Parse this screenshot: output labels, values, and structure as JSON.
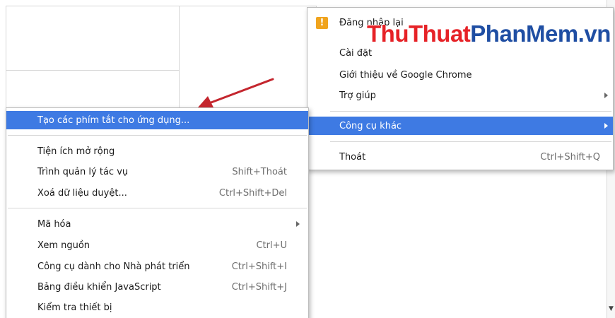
{
  "main_menu": {
    "items": [
      {
        "label": "Đăng nhập lại"
      },
      {
        "label": "Cài đặt"
      },
      {
        "label": "Giới thiệu về Google Chrome"
      },
      {
        "label": "Trợ giúp"
      },
      {
        "label": "Công cụ khác"
      },
      {
        "label": "Thoát",
        "shortcut": "Ctrl+Shift+Q"
      }
    ],
    "warning_icon_glyph": "!"
  },
  "sub_menu": {
    "items": [
      {
        "label": "Tạo các phím tắt cho ứng dụng..."
      },
      {
        "label": "Tiện ích mở rộng"
      },
      {
        "label": "Trình quản lý tác vụ",
        "shortcut": "Shift+Thoát"
      },
      {
        "label": "Xoá dữ liệu duyệt...",
        "shortcut": "Ctrl+Shift+Del"
      },
      {
        "label": "Mã hóa"
      },
      {
        "label": "Xem nguồn",
        "shortcut": "Ctrl+U"
      },
      {
        "label": "Công cụ dành cho Nhà phát triển",
        "shortcut": "Ctrl+Shift+I"
      },
      {
        "label": "Bảng điều khiển JavaScript",
        "shortcut": "Ctrl+Shift+J"
      },
      {
        "label": "Kiểm tra thiết bị"
      }
    ]
  },
  "watermark": {
    "part1": "ThuThuat",
    "part2": "PhanMem",
    "part3": ".vn"
  },
  "colors": {
    "highlight": "#3e7ae3",
    "pointer_arrow": "#c4262e",
    "watermark_red": "#e62227",
    "watermark_blue": "#1f4ea3",
    "warning_icon": "#f0a41e"
  }
}
